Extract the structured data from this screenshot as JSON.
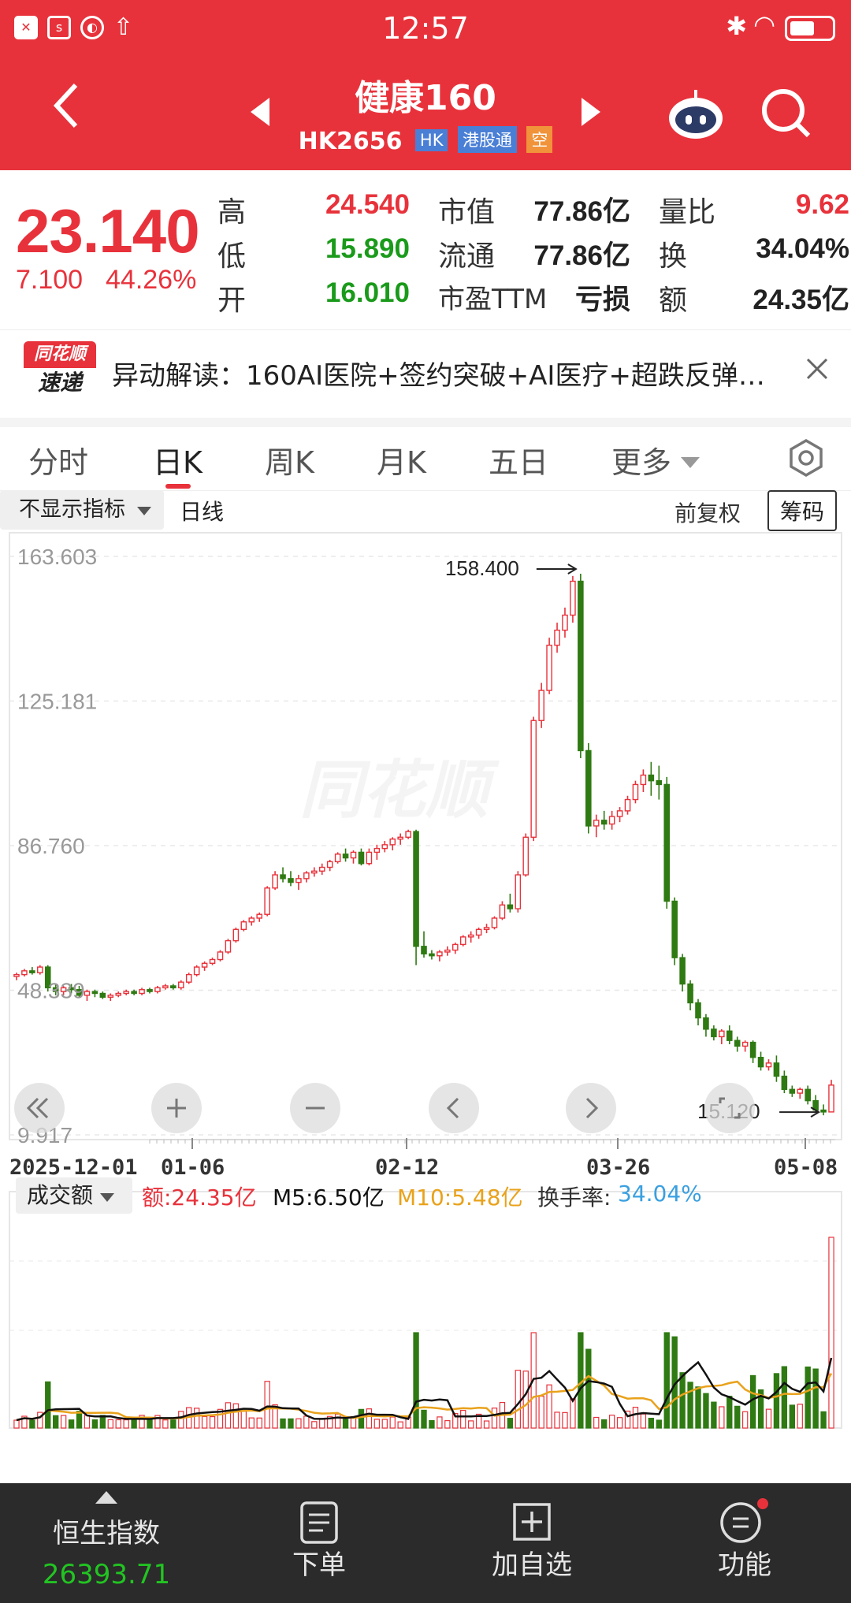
{
  "status_bar": {
    "time": "12:57"
  },
  "header": {
    "title": "健康160",
    "code": "HK2656",
    "tags": [
      "HK",
      "港股通",
      "空"
    ]
  },
  "quote": {
    "price": "23.140",
    "change": "7.100",
    "change_pct": "44.26%",
    "cells": [
      {
        "label": "高",
        "value": "24.540"
      },
      {
        "label": "市值",
        "value": "77.86亿"
      },
      {
        "label": "量比",
        "value": "9.62"
      },
      {
        "label": "低",
        "value": "15.890"
      },
      {
        "label": "流通",
        "value": "77.86亿"
      },
      {
        "label": "换",
        "value": "34.04%"
      },
      {
        "label": "开",
        "value": "16.010"
      },
      {
        "label": "市盈TTM",
        "value": "亏损"
      },
      {
        "label": "额",
        "value": "24.35亿"
      }
    ]
  },
  "news": {
    "logo_top": "同花顺",
    "logo_bottom": "速递",
    "text": "异动解读：160AI医院+签约突破+AI医疗+超跌反弹…"
  },
  "tabs": [
    "分时",
    "日K",
    "周K",
    "月K",
    "五日",
    "更多"
  ],
  "toolbar": {
    "indicator": "不显示指标",
    "period": "日线",
    "adjust": "前复权",
    "chips": "筹码"
  },
  "chart_data": {
    "type": "candlestick",
    "y_ticks": [
      "163.603",
      "125.181",
      "86.760",
      "48.339",
      "9.917"
    ],
    "x_ticks": [
      "2025-12-01",
      "01-06",
      "02-12",
      "03-26",
      "05-08"
    ],
    "max_marker": "158.400",
    "min_marker": "15.120",
    "ylim": [
      9.917,
      163.603
    ],
    "candles": [
      [
        52,
        53,
        51,
        52.5
      ],
      [
        52.5,
        54,
        52,
        53.5
      ],
      [
        53.5,
        54.5,
        52.5,
        53
      ],
      [
        53,
        55,
        52.5,
        54.5
      ],
      [
        54.5,
        55,
        48,
        49
      ],
      [
        49,
        50,
        47,
        48
      ],
      [
        48,
        49.5,
        47,
        49
      ],
      [
        49,
        50,
        47.5,
        48.5
      ],
      [
        48.5,
        49.5,
        46.5,
        47
      ],
      [
        47,
        48.5,
        45.5,
        48
      ],
      [
        48,
        48.5,
        46.5,
        47.5
      ],
      [
        47.5,
        48,
        46,
        46.5
      ],
      [
        46.5,
        47.5,
        45.5,
        47
      ],
      [
        47,
        48,
        46.5,
        47.5
      ],
      [
        47.5,
        48.5,
        47,
        48
      ],
      [
        48,
        48.5,
        47,
        47.5
      ],
      [
        47.5,
        49,
        47,
        48.5
      ],
      [
        48.5,
        49,
        47.5,
        48
      ],
      [
        48,
        49.5,
        47.5,
        49
      ],
      [
        49,
        50,
        48.5,
        49.5
      ],
      [
        49.5,
        50,
        48.5,
        49
      ],
      [
        49,
        51,
        48.5,
        50.5
      ],
      [
        50.5,
        53,
        50,
        52.5
      ],
      [
        52.5,
        55,
        52,
        54.5
      ],
      [
        54.5,
        56,
        53.5,
        55.5
      ],
      [
        55.5,
        57,
        55,
        56.5
      ],
      [
        56.5,
        59,
        56,
        58.5
      ],
      [
        58.5,
        62,
        58,
        61.5
      ],
      [
        61.5,
        65,
        61,
        64.5
      ],
      [
        64.5,
        67,
        64,
        66.5
      ],
      [
        66.5,
        68,
        65.5,
        67.5
      ],
      [
        67.5,
        69,
        66.5,
        68.5
      ],
      [
        68.5,
        76,
        68,
        75.5
      ],
      [
        75.5,
        80,
        75,
        79
      ],
      [
        79,
        81,
        77,
        78
      ],
      [
        78,
        80,
        76,
        77
      ],
      [
        77,
        79,
        75,
        78
      ],
      [
        78,
        80,
        77,
        79.5
      ],
      [
        79.5,
        81,
        78.5,
        80
      ],
      [
        80,
        82,
        79,
        81
      ],
      [
        81,
        83,
        80,
        82.5
      ],
      [
        82.5,
        85,
        82,
        84.5
      ],
      [
        84.5,
        86,
        82.5,
        83.5
      ],
      [
        83.5,
        85.5,
        82,
        85
      ],
      [
        85,
        86,
        81.5,
        82
      ],
      [
        82,
        86,
        81.5,
        85
      ],
      [
        85,
        87,
        83,
        86
      ],
      [
        86,
        88,
        85,
        87
      ],
      [
        87,
        89,
        85.5,
        88.5
      ],
      [
        88.5,
        90,
        87,
        89
      ],
      [
        89,
        91,
        88.5,
        90.5
      ],
      [
        90.5,
        91,
        55,
        60
      ],
      [
        60,
        64,
        57,
        58
      ],
      [
        58,
        59,
        56.5,
        57.5
      ],
      [
        57.5,
        59,
        56,
        58.5
      ],
      [
        58.5,
        60,
        57.5,
        59
      ],
      [
        59,
        61,
        58,
        60.5
      ],
      [
        60.5,
        63,
        60,
        62.5
      ],
      [
        62.5,
        64,
        61,
        63
      ],
      [
        63,
        65,
        62,
        64.5
      ],
      [
        64.5,
        66,
        63.5,
        65
      ],
      [
        65,
        68,
        64.5,
        67.5
      ],
      [
        67.5,
        72,
        67,
        71
      ],
      [
        71,
        74,
        69,
        70
      ],
      [
        70,
        80,
        69,
        79
      ],
      [
        79,
        90,
        78.5,
        89
      ],
      [
        89,
        121,
        88,
        120
      ],
      [
        120,
        130,
        118,
        128
      ],
      [
        128,
        142,
        127,
        140
      ],
      [
        140,
        146,
        138,
        144
      ],
      [
        144,
        150,
        142,
        148
      ],
      [
        148,
        158.4,
        146,
        157
      ],
      [
        157,
        159,
        110,
        112
      ],
      [
        112,
        114,
        90,
        92
      ],
      [
        92,
        95,
        89,
        93.5
      ],
      [
        93.5,
        96,
        91,
        92.5
      ],
      [
        92.5,
        96,
        91,
        94.5
      ],
      [
        94.5,
        97,
        93,
        96
      ],
      [
        96,
        100,
        95,
        99
      ],
      [
        99,
        104,
        98,
        103
      ],
      [
        103,
        107,
        101,
        105.5
      ],
      [
        105.5,
        109,
        100,
        104
      ],
      [
        104,
        108,
        99,
        103
      ],
      [
        103,
        105,
        70,
        72
      ],
      [
        72,
        73,
        55,
        57
      ],
      [
        57,
        58,
        48,
        50
      ],
      [
        50,
        51,
        43,
        45
      ],
      [
        45,
        46,
        39,
        41
      ],
      [
        41,
        42,
        36,
        38
      ],
      [
        38,
        39,
        35,
        36
      ],
      [
        36,
        38,
        34,
        37.5
      ],
      [
        37.5,
        39,
        34,
        35
      ],
      [
        35,
        36,
        32,
        33.5
      ],
      [
        33.5,
        35,
        32,
        34.5
      ],
      [
        34.5,
        35,
        29,
        30.5
      ],
      [
        30.5,
        32,
        27,
        28
      ],
      [
        28,
        30,
        27,
        29
      ],
      [
        29,
        31,
        24,
        25.5
      ],
      [
        25.5,
        27,
        21,
        22
      ],
      [
        22,
        23,
        20,
        21
      ],
      [
        21,
        22.5,
        19.5,
        22
      ],
      [
        22,
        23,
        18,
        19
      ],
      [
        19,
        20.5,
        16,
        16.5
      ],
      [
        16.5,
        18,
        15.12,
        16.01
      ],
      [
        16.01,
        24.54,
        15.89,
        23.14
      ]
    ],
    "volume_legend": {
      "label": "成交额",
      "amount": "额:24.35亿",
      "m5": "M5:6.50亿",
      "m10": "M10:5.48亿",
      "turnover_label": "换手率:",
      "turnover": "34.04%"
    },
    "colors": {
      "up": "#e8323b",
      "down": "#2f7a12",
      "m5": "#111111",
      "m10": "#e9a21b"
    }
  },
  "bottom_nav": {
    "index_name": "恒生指数",
    "index_value": "26393.71",
    "items": [
      "下单",
      "加自选",
      "功能"
    ]
  }
}
